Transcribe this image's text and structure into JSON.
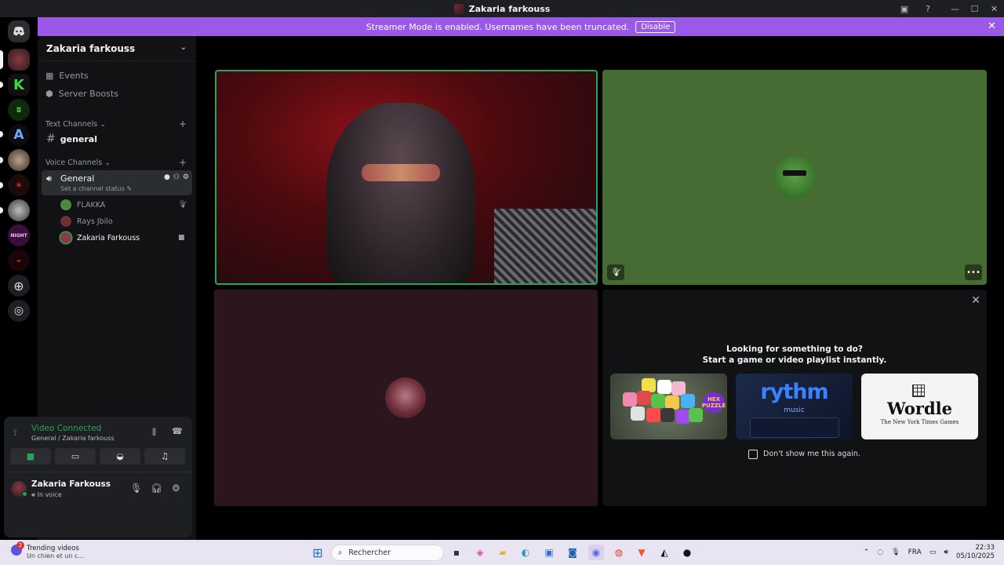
{
  "window": {
    "title": "Zakaria farkouss"
  },
  "banner": {
    "message": "Streamer Mode is enabled. Usernames have been truncated.",
    "action_label": "Disable"
  },
  "server": {
    "name": "Zakaria farkouss",
    "links": [
      {
        "label": "Events",
        "icon": "calendar-icon"
      },
      {
        "label": "Server Boosts",
        "icon": "boost-icon"
      }
    ],
    "text_category": "Text Channels",
    "text_channels": [
      {
        "name": "general"
      }
    ],
    "voice_category": "Voice Channels",
    "voice_channel": {
      "name": "General",
      "status_placeholder": "Set a channel status"
    },
    "members": [
      {
        "name": "FLAKKA",
        "state": "muted"
      },
      {
        "name": "Rays Jbilo",
        "state": ""
      },
      {
        "name": "Zakaria Farkouss",
        "state": "camera"
      }
    ]
  },
  "voice_panel": {
    "status": "Video Connected",
    "location": "General / Zakaria farkouss",
    "user_name": "Zakaria Farkouss",
    "user_status": "In voice"
  },
  "activity": {
    "heading_line1": "Looking for something to do?",
    "heading_line2": "Start a game or video playlist instantly.",
    "cards": [
      {
        "name": "Hex Puzzle",
        "badge": "HEX PUZZLE"
      },
      {
        "name": "Rythm",
        "logo": "rythm",
        "sub": "music"
      },
      {
        "name": "Wordle",
        "title": "Wordle",
        "sub": "The New York Times Games"
      }
    ],
    "checkbox_label": "Don't show me this again."
  },
  "taskbar": {
    "news_title": "Trending videos",
    "news_sub": "Un chien et un c...",
    "news_badge": "2",
    "search_placeholder": "Rechercher",
    "language": "FRA",
    "time": "22:33",
    "date": "05/10/2025"
  },
  "colors": {
    "accent": "#9b59e7",
    "connected": "#23a55a",
    "sidebar": "#121214"
  }
}
